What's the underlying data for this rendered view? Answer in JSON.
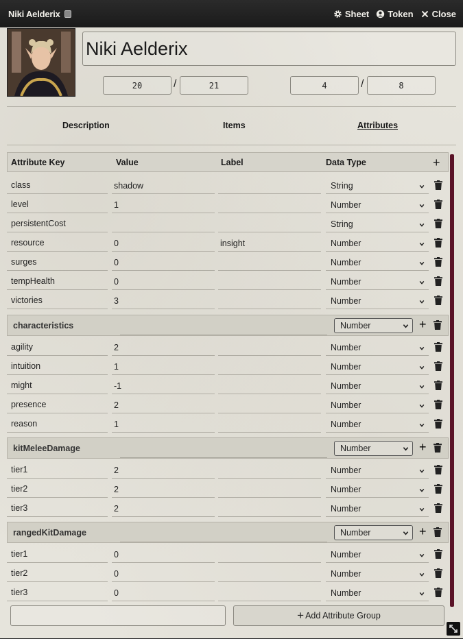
{
  "window": {
    "title": "Niki Aelderix",
    "actions": {
      "sheet": "Sheet",
      "token": "Token",
      "close": "Close"
    }
  },
  "actor": {
    "name": "Niki Aelderix",
    "stat1_value": "20",
    "stat1_max": "21",
    "stat2_value": "4",
    "stat2_max": "8"
  },
  "tabs": [
    {
      "label": "Description"
    },
    {
      "label": "Items"
    },
    {
      "label": "Attributes"
    }
  ],
  "columns": {
    "key": "Attribute Key",
    "value": "Value",
    "label": "Label",
    "type": "Data Type"
  },
  "attributes": [
    {
      "key": "class",
      "value": "shadow",
      "label": "",
      "type": "String"
    },
    {
      "key": "level",
      "value": "1",
      "label": "",
      "type": "Number"
    },
    {
      "key": "persistentCost",
      "value": "",
      "label": "",
      "type": "String"
    },
    {
      "key": "resource",
      "value": "0",
      "label": "insight",
      "type": "Number"
    },
    {
      "key": "surges",
      "value": "0",
      "label": "",
      "type": "Number"
    },
    {
      "key": "tempHealth",
      "value": "0",
      "label": "",
      "type": "Number"
    },
    {
      "key": "victories",
      "value": "3",
      "label": "",
      "type": "Number"
    }
  ],
  "groups": [
    {
      "name": "characteristics",
      "type": "Number",
      "rows": [
        {
          "key": "agility",
          "value": "2",
          "type": "Number"
        },
        {
          "key": "intuition",
          "value": "1",
          "type": "Number"
        },
        {
          "key": "might",
          "value": "-1",
          "type": "Number"
        },
        {
          "key": "presence",
          "value": "2",
          "type": "Number"
        },
        {
          "key": "reason",
          "value": "1",
          "type": "Number"
        }
      ]
    },
    {
      "name": "kitMeleeDamage",
      "type": "Number",
      "rows": [
        {
          "key": "tier1",
          "value": "2",
          "type": "Number"
        },
        {
          "key": "tier2",
          "value": "2",
          "type": "Number"
        },
        {
          "key": "tier3",
          "value": "2",
          "type": "Number"
        }
      ]
    },
    {
      "name": "rangedKitDamage",
      "type": "Number",
      "rows": [
        {
          "key": "tier1",
          "value": "0",
          "type": "Number"
        },
        {
          "key": "tier2",
          "value": "0",
          "type": "Number"
        },
        {
          "key": "tier3",
          "value": "0",
          "type": "Number"
        }
      ]
    }
  ],
  "footer": {
    "add_group_label": "Add Attribute Group"
  },
  "colors": {
    "scrollbar": "#5a1327",
    "titlebar": "#1a1a1a",
    "panel": "#e6e4dc"
  }
}
